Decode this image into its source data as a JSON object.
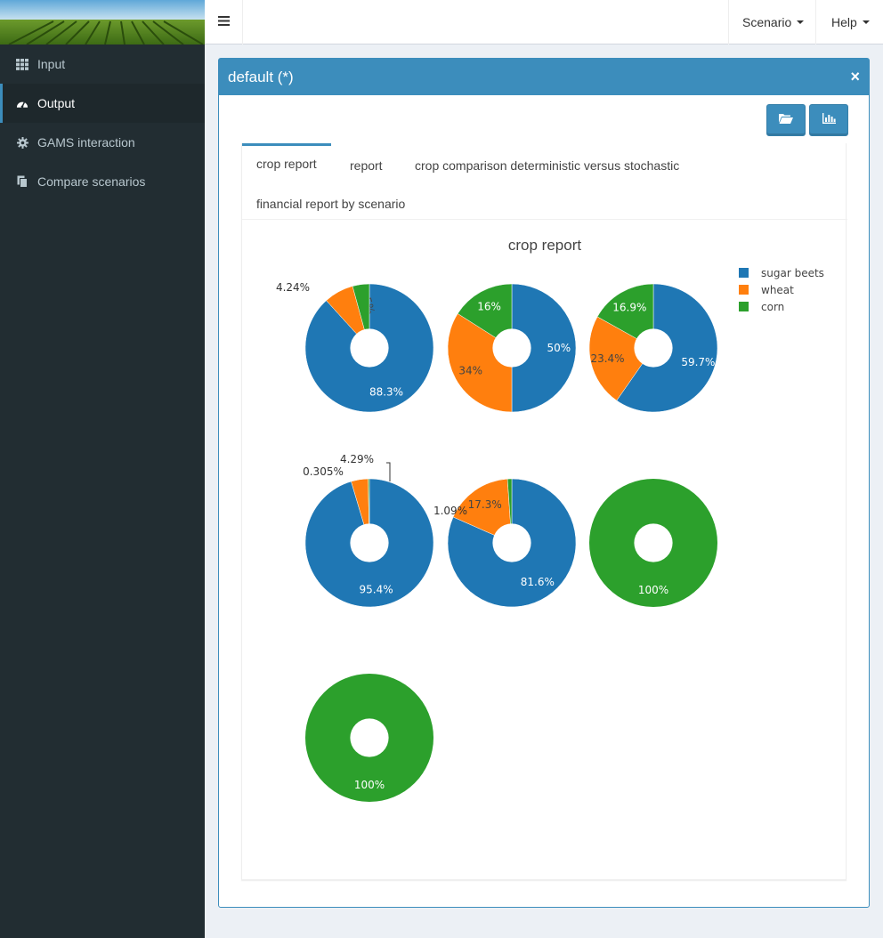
{
  "nav": {
    "scenario_label": "Scenario",
    "help_label": "Help"
  },
  "sidebar": {
    "items": [
      {
        "label": "Input",
        "icon": "grid-icon"
      },
      {
        "label": "Output",
        "icon": "dashboard-icon",
        "active": true
      },
      {
        "label": "GAMS interaction",
        "icon": "gear-icon"
      },
      {
        "label": "Compare scenarios",
        "icon": "copy-icon"
      }
    ]
  },
  "box": {
    "title": "default (*)",
    "close_label": "×",
    "buttons": [
      {
        "icon": "folder-open-icon"
      },
      {
        "icon": "bar-chart-icon"
      }
    ]
  },
  "tabs": [
    {
      "label": "crop report",
      "active": true
    },
    {
      "label": "report"
    },
    {
      "label": "crop comparison deterministic versus stochastic"
    },
    {
      "label": "financial report by scenario"
    }
  ],
  "colors": {
    "accent": "#3c8dbc",
    "sidebar_bg": "#222d32",
    "sugar_beets": "#1f77b4",
    "wheat": "#ff7f0e",
    "corn": "#2ca02c"
  },
  "chart_data": {
    "type": "pie",
    "title": "crop report",
    "legend": [
      "sugar beets",
      "wheat",
      "corn"
    ],
    "legend_position": "top-right",
    "hole": 0.3,
    "pies": [
      {
        "values": [
          88.3,
          7.5,
          4.24
        ],
        "labels": [
          "88.3%",
          "7.5%",
          "4.24%"
        ]
      },
      {
        "values": [
          50,
          34,
          16
        ],
        "labels": [
          "50%",
          "34%",
          "16%"
        ]
      },
      {
        "values": [
          59.7,
          23.4,
          16.9
        ],
        "labels": [
          "59.7%",
          "23.4%",
          "16.9%"
        ]
      },
      {
        "values": [
          95.4,
          4.29,
          0.305
        ],
        "labels": [
          "95.4%",
          "4.29%",
          "0.305%"
        ]
      },
      {
        "values": [
          81.6,
          17.3,
          1.09
        ],
        "labels": [
          "81.6%",
          "17.3%",
          "1.09%"
        ]
      },
      {
        "values": [
          0,
          0,
          100
        ],
        "labels": [
          "",
          "",
          "100%"
        ]
      },
      {
        "values": [
          0,
          0,
          100
        ],
        "labels": [
          "",
          "",
          "100%"
        ]
      }
    ]
  }
}
